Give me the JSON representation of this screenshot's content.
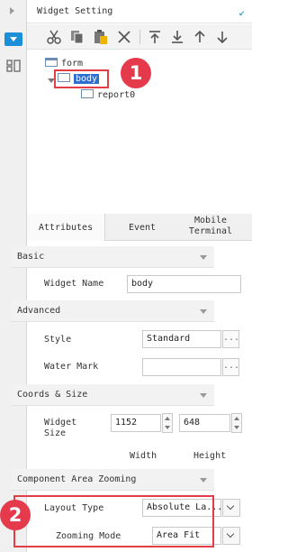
{
  "window": {
    "title": "Widget Setting"
  },
  "toolbar": {
    "buttons": [
      "cut",
      "copy",
      "paste",
      "delete",
      "move-to-top",
      "move-to-bottom",
      "move-up",
      "move-down"
    ]
  },
  "tree": {
    "root": "form",
    "selected": "body",
    "child": "report0"
  },
  "tabs": [
    "Attributes",
    "Event",
    "Mobile Terminal"
  ],
  "sections": {
    "basic": "Basic",
    "advanced": "Advanced",
    "coords": "Coords & Size",
    "zooming": "Component Area Zooming"
  },
  "props": {
    "widget_name_label": "Widget Name",
    "widget_name_value": "body",
    "style_label": "Style",
    "style_value": "Standard",
    "water_mark_label": "Water Mark",
    "water_mark_value": "",
    "widget_size_label": "Widget Size",
    "width_value": "1152",
    "height_value": "648",
    "width_label": "Width",
    "height_label": "Height",
    "layout_type_label": "Layout Type",
    "layout_type_value": "Absolute La...",
    "zooming_mode_label": "Zooming Mode",
    "zooming_mode_value": "Area Fit",
    "dots": "..."
  },
  "callouts": {
    "one": "1",
    "two": "2"
  },
  "colors": {
    "accent": "#1b8fd8",
    "selection": "#2d6fd1",
    "callout": "#e33d48"
  }
}
